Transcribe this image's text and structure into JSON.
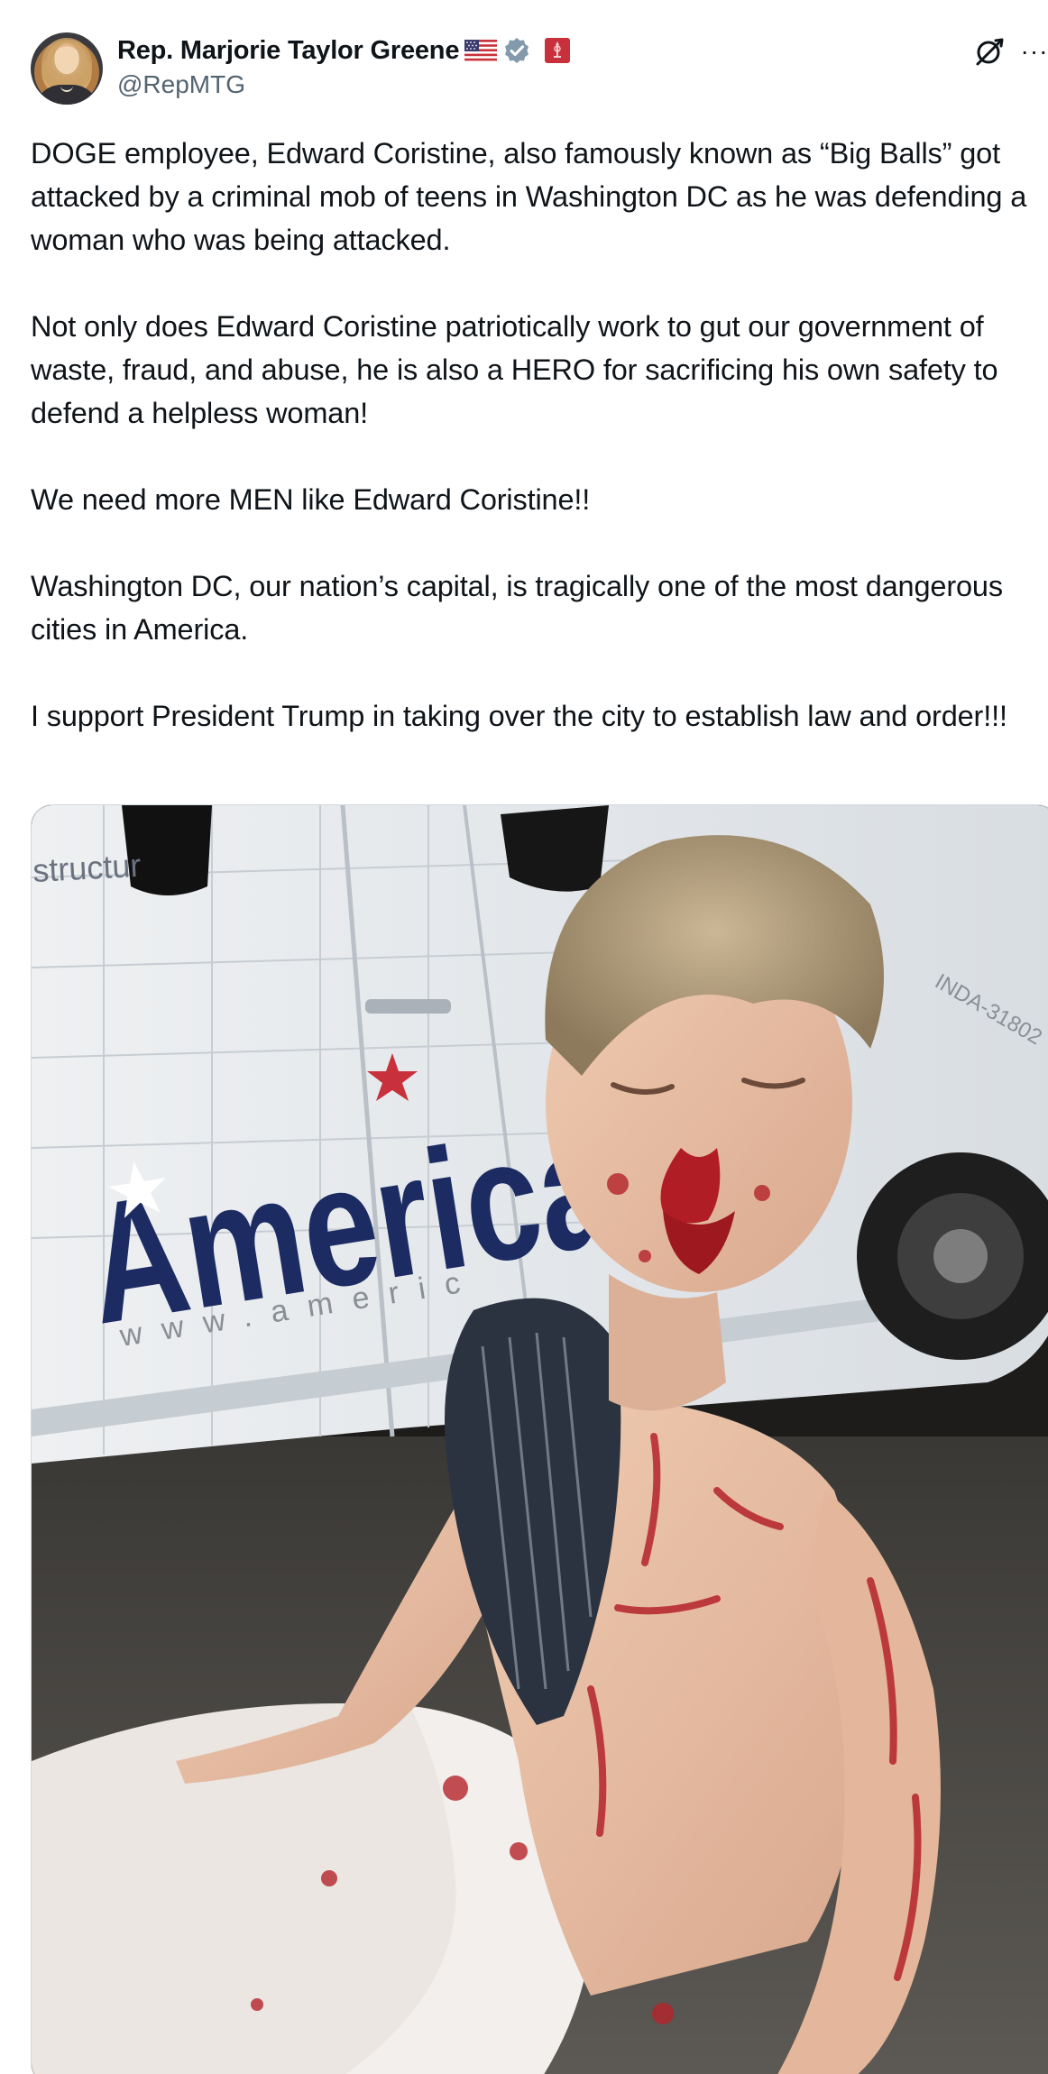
{
  "author": {
    "display_name": "Rep. Marjorie Taylor Greene",
    "handle": "@RepMTG",
    "badges": [
      "us-flag-icon",
      "verified-icon",
      "government-badge-icon"
    ]
  },
  "actions": {
    "grok_icon": "grok-icon",
    "more_label": "···"
  },
  "post": {
    "paragraphs": [
      "DOGE employee, Edward Coristine, also famously known as “Big Balls” got attacked by a criminal mob of teens in Washington DC as he was defending a woman who was being attacked.",
      "Not only does Edward Coristine patriotically work to gut our government of waste, fraud, and abuse, he is also a HERO for sacrificing his own safety to defend a helpless woman!",
      "We need more MEN like Edward Coristine!!",
      "Washington DC, our nation’s capital, is tragically one of the most dangerous cities in America.",
      "I support President Trump in taking over the city to establish law and order!!!"
    ]
  },
  "media": {
    "van_brand": "American",
    "van_small_text": "structur",
    "van_url": "www.americ",
    "plate_text": "INDA-31802"
  },
  "colors": {
    "text": "#0f1419",
    "secondary": "#536471",
    "verified": "#829aab",
    "gov_badge": "#c8313b"
  }
}
